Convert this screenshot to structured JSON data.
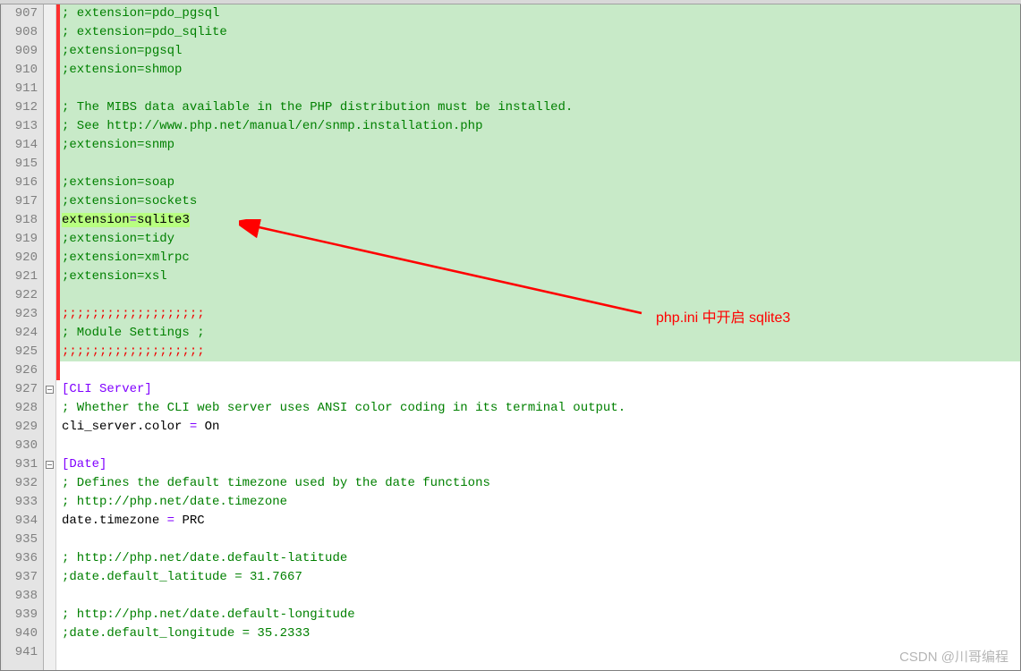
{
  "annotation": {
    "label": "php.ini 中开启 sqlite3",
    "color": "#ff0000"
  },
  "watermark": "CSDN @川哥编程",
  "colors": {
    "highlight_bg": "#c8eac8",
    "text_highlight": "#b8ff80",
    "change_marker": "#ff3030",
    "comment": "#008000",
    "section": "#8000ff"
  },
  "first_line_number": 907,
  "lines": [
    {
      "num": 907,
      "bg": "green",
      "changed": true,
      "segs": [
        {
          "cls": "comment",
          "t": "; extension=pdo_pgsql"
        }
      ]
    },
    {
      "num": 908,
      "bg": "green",
      "changed": true,
      "segs": [
        {
          "cls": "comment",
          "t": "; extension=pdo_sqlite"
        }
      ]
    },
    {
      "num": 909,
      "bg": "green",
      "changed": true,
      "segs": [
        {
          "cls": "comment",
          "t": ";extension=pgsql"
        }
      ]
    },
    {
      "num": 910,
      "bg": "green",
      "changed": true,
      "segs": [
        {
          "cls": "comment",
          "t": ";extension=shmop"
        }
      ]
    },
    {
      "num": 911,
      "bg": "green",
      "changed": true,
      "segs": []
    },
    {
      "num": 912,
      "bg": "green",
      "changed": true,
      "segs": [
        {
          "cls": "comment",
          "t": "; The MIBS data available in the PHP distribution must be installed."
        }
      ]
    },
    {
      "num": 913,
      "bg": "green",
      "changed": true,
      "segs": [
        {
          "cls": "comment",
          "t": "; See http://www.php.net/manual/en/snmp.installation.php"
        }
      ]
    },
    {
      "num": 914,
      "bg": "green",
      "changed": true,
      "segs": [
        {
          "cls": "comment",
          "t": ";extension=snmp"
        }
      ]
    },
    {
      "num": 915,
      "bg": "green",
      "changed": true,
      "segs": []
    },
    {
      "num": 916,
      "bg": "green",
      "changed": true,
      "segs": [
        {
          "cls": "comment",
          "t": ";extension=soap"
        }
      ]
    },
    {
      "num": 917,
      "bg": "green",
      "changed": true,
      "segs": [
        {
          "cls": "comment",
          "t": ";extension=sockets"
        }
      ]
    },
    {
      "num": 918,
      "bg": "green",
      "changed": true,
      "hl": true,
      "segs": [
        {
          "cls": "key",
          "t": "extension"
        },
        {
          "cls": "op",
          "t": "="
        },
        {
          "cls": "val",
          "t": "sqlite3"
        }
      ]
    },
    {
      "num": 919,
      "bg": "green",
      "changed": true,
      "segs": [
        {
          "cls": "comment",
          "t": ";extension=tidy"
        }
      ]
    },
    {
      "num": 920,
      "bg": "green",
      "changed": true,
      "segs": [
        {
          "cls": "comment",
          "t": ";extension=xmlrpc"
        }
      ]
    },
    {
      "num": 921,
      "bg": "green",
      "changed": true,
      "segs": [
        {
          "cls": "comment",
          "t": ";extension=xsl"
        }
      ]
    },
    {
      "num": 922,
      "bg": "green",
      "changed": true,
      "segs": []
    },
    {
      "num": 923,
      "bg": "green",
      "changed": true,
      "segs": [
        {
          "cls": "comment-red",
          "t": ";;;;;;;;;;;;;;;;;;;"
        }
      ]
    },
    {
      "num": 924,
      "bg": "green",
      "changed": true,
      "segs": [
        {
          "cls": "comment",
          "t": "; Module Settings ;"
        }
      ]
    },
    {
      "num": 925,
      "bg": "green",
      "changed": true,
      "segs": [
        {
          "cls": "comment-red",
          "t": ";;;;;;;;;;;;;;;;;;;"
        }
      ]
    },
    {
      "num": 926,
      "bg": "",
      "changed": true,
      "segs": []
    },
    {
      "num": 927,
      "bg": "",
      "fold": true,
      "segs": [
        {
          "cls": "section",
          "t": "[CLI Server]"
        }
      ]
    },
    {
      "num": 928,
      "bg": "",
      "segs": [
        {
          "cls": "comment",
          "t": "; Whether the CLI web server uses ANSI color coding in its terminal output."
        }
      ]
    },
    {
      "num": 929,
      "bg": "",
      "segs": [
        {
          "cls": "key",
          "t": "cli_server.color"
        },
        {
          "cls": "op",
          "t": " = "
        },
        {
          "cls": "val",
          "t": "On"
        }
      ]
    },
    {
      "num": 930,
      "bg": "",
      "segs": []
    },
    {
      "num": 931,
      "bg": "",
      "fold": true,
      "segs": [
        {
          "cls": "section",
          "t": "[Date]"
        }
      ]
    },
    {
      "num": 932,
      "bg": "",
      "segs": [
        {
          "cls": "comment",
          "t": "; Defines the default timezone used by the date functions"
        }
      ]
    },
    {
      "num": 933,
      "bg": "",
      "segs": [
        {
          "cls": "comment",
          "t": "; http://php.net/date.timezone"
        }
      ]
    },
    {
      "num": 934,
      "bg": "",
      "segs": [
        {
          "cls": "key",
          "t": "date.timezone"
        },
        {
          "cls": "op",
          "t": " = "
        },
        {
          "cls": "val",
          "t": "PRC"
        }
      ]
    },
    {
      "num": 935,
      "bg": "",
      "segs": []
    },
    {
      "num": 936,
      "bg": "",
      "segs": [
        {
          "cls": "comment",
          "t": "; http://php.net/date.default-latitude"
        }
      ]
    },
    {
      "num": 937,
      "bg": "",
      "segs": [
        {
          "cls": "comment",
          "t": ";date.default_latitude = 31.7667"
        }
      ]
    },
    {
      "num": 938,
      "bg": "",
      "segs": []
    },
    {
      "num": 939,
      "bg": "",
      "segs": [
        {
          "cls": "comment",
          "t": "; http://php.net/date.default-longitude"
        }
      ]
    },
    {
      "num": 940,
      "bg": "",
      "segs": [
        {
          "cls": "comment",
          "t": ";date.default_longitude = 35.2333"
        }
      ]
    },
    {
      "num": 941,
      "bg": "",
      "segs": []
    }
  ]
}
